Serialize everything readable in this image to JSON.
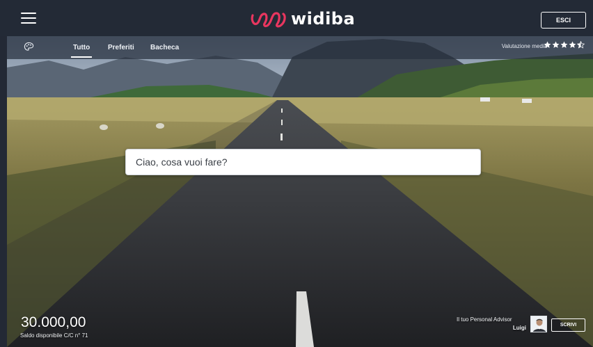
{
  "header": {
    "menu_icon": "hamburger-menu-icon",
    "brand_name": "widiba",
    "brand_color": "#e8365f",
    "logout_label": "ESCI"
  },
  "subnav": {
    "palette_icon": "palette-icon",
    "tabs": [
      {
        "label": "Tutto",
        "active": true
      },
      {
        "label": "Preferiti",
        "active": false
      },
      {
        "label": "Bacheca",
        "active": false
      }
    ],
    "rating_label": "Valutazione media",
    "rating_value": 4.5,
    "rating_max": 5
  },
  "chat": {
    "placeholder": "Ciao, cosa vuoi fare?"
  },
  "account": {
    "balance": "30.000,00",
    "caption": "Saldo disponibile C/C n° 71"
  },
  "advisor": {
    "title": "Il tuo Personal Advisor",
    "name": "Luigi",
    "write_label": "SCRIVI"
  }
}
